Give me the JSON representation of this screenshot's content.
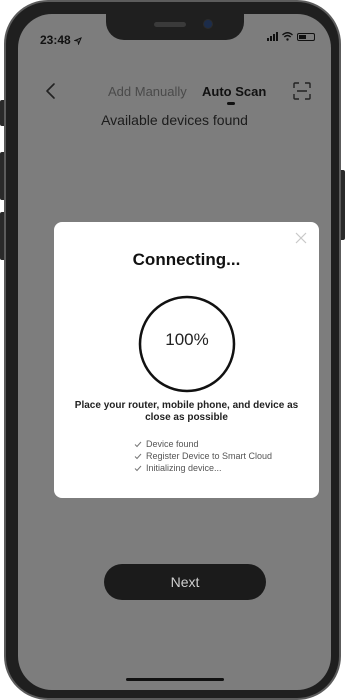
{
  "status_bar": {
    "time": "23:48",
    "location_icon": "location-arrow-icon",
    "signal_icon": "signal-bars-icon",
    "wifi_icon": "wifi-icon",
    "battery_icon": "battery-icon"
  },
  "nav": {
    "back_icon": "chevron-left-icon",
    "tabs": [
      {
        "label": "Add Manually",
        "active": false
      },
      {
        "label": "Auto Scan",
        "active": true
      }
    ],
    "scan_icon": "qr-scan-icon"
  },
  "subtitle": "Available devices found",
  "modal": {
    "title": "Connecting...",
    "progress_percent": 100,
    "progress_label": "100%",
    "instruction": "Place your router, mobile phone, and device as close as possible",
    "close_icon": "close-icon",
    "steps": [
      {
        "label": "Device found",
        "icon": "check-icon"
      },
      {
        "label": "Register Device to Smart Cloud",
        "icon": "check-icon"
      },
      {
        "label": "Initializing device...",
        "icon": "check-icon"
      }
    ]
  },
  "next_button": {
    "label": "Next"
  },
  "colors": {
    "overlay": "#7d7d7d",
    "modal_bg": "#ffffff",
    "button_bg": "#1b1b1b",
    "button_text": "#cfcfcf",
    "accent_text": "#111111"
  }
}
